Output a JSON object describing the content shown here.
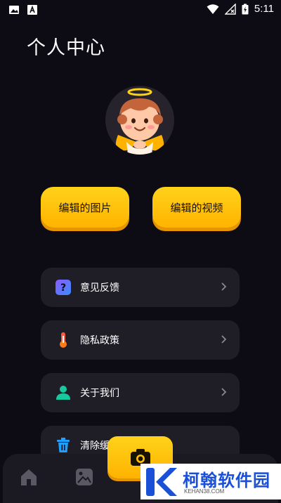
{
  "status_bar": {
    "time": "5:11",
    "icons": [
      "image-icon",
      "text-a-icon",
      "wifi-icon",
      "no-signal-icon",
      "battery-charging-icon"
    ]
  },
  "page": {
    "title": "个人中心"
  },
  "actions": {
    "edited_images": "编辑的图片",
    "edited_videos": "编辑的视频"
  },
  "menu": [
    {
      "label": "意见反馈",
      "icon": "question-icon"
    },
    {
      "label": "隐私政策",
      "icon": "thermometer-icon"
    },
    {
      "label": "关于我们",
      "icon": "person-icon"
    },
    {
      "label": "清除缓",
      "icon": "trash-icon"
    }
  ],
  "bottom_nav": {
    "items": [
      "home-icon",
      "gallery-icon",
      "camera-icon"
    ]
  },
  "watermark": {
    "brand": "柯翰软件园",
    "site": "KEHAN38.COM"
  },
  "colors": {
    "background": "#0d0b14",
    "accent": "#ffc107",
    "card": "#1f1d25",
    "watermark_blue": "#1a4fd8"
  }
}
